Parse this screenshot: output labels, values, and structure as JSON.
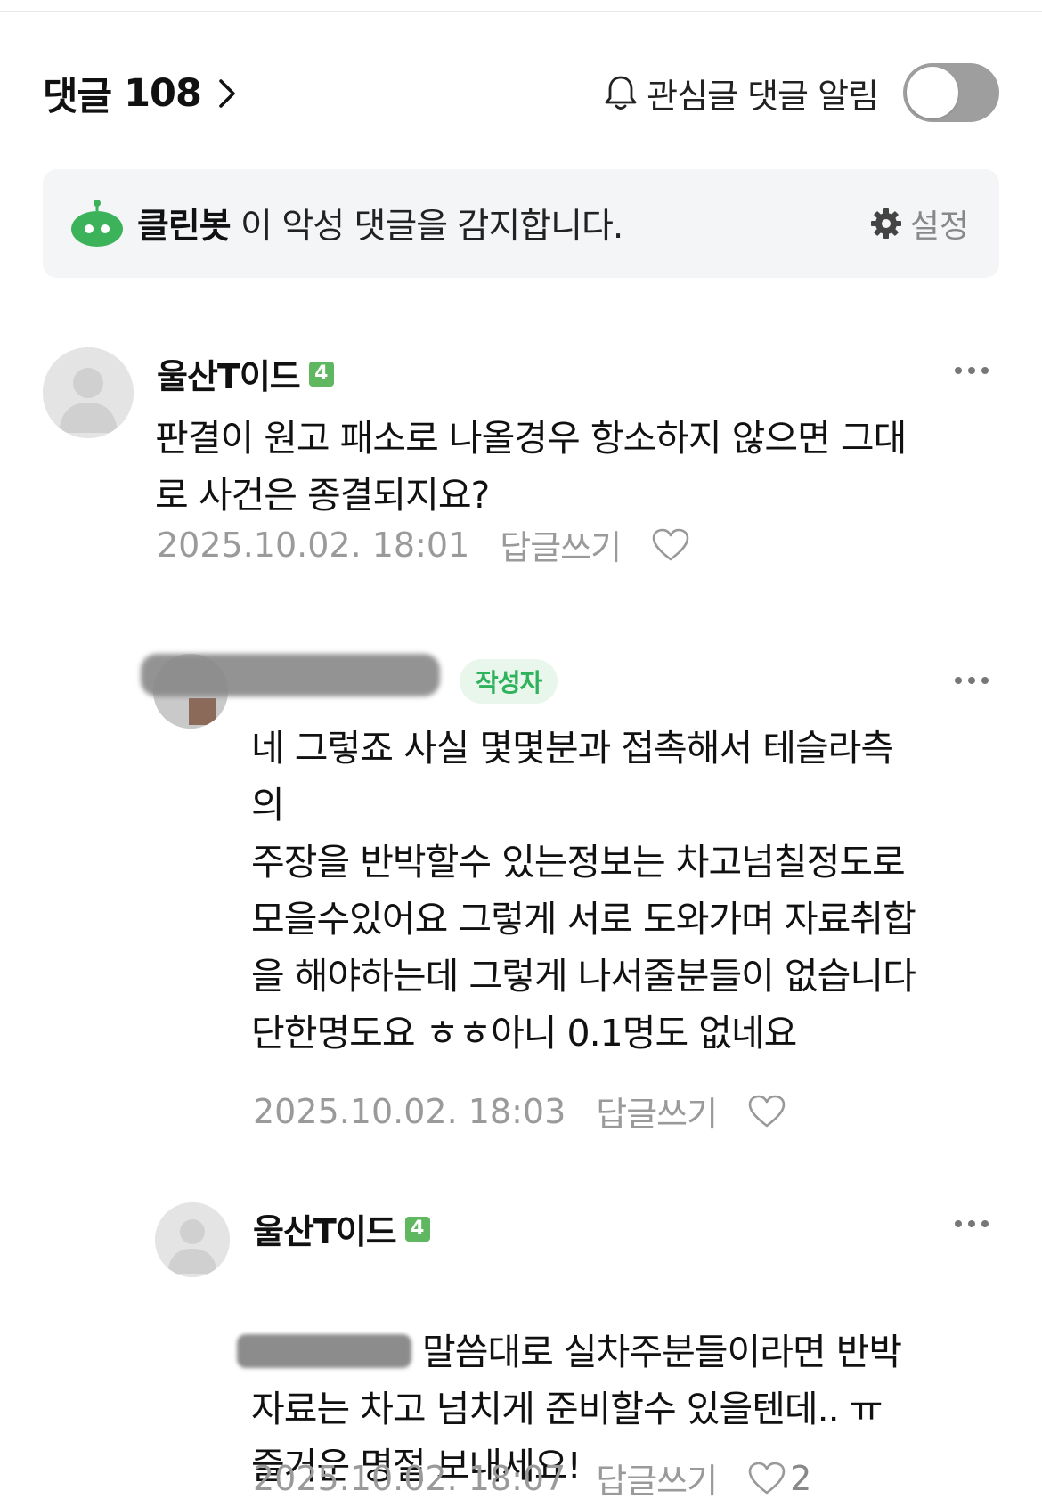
{
  "header": {
    "title": "댓글",
    "count": "108",
    "notify_label": "관심글 댓글 알림",
    "toggle_on": false
  },
  "banner": {
    "bot_name": "클린봇",
    "message": " 이 악성 댓글을 감지합니다.",
    "settings_label": "설정"
  },
  "colors": {
    "accent_green": "#2fb25b",
    "level_badge": "#5fb85f",
    "banner_bg": "#f3f5f7",
    "toggle_off": "#9e9e9e"
  },
  "comments": [
    {
      "author": "울산T이드",
      "level": "4",
      "text": "판결이 원고 패소로 나올경우 항소하지 않으면 그대\n로 사건은 종결되지요?",
      "timestamp": "2025.10.02. 18:01",
      "reply_label": "답글쓰기",
      "likes": ""
    },
    {
      "author": "",
      "writer_badge": "작성자",
      "text": "네 그렇죠 사실 몇몇분과 접촉해서 테슬라측\n의\n주장을 반박할수 있는정보는 차고넘칠정도로\n모을수있어요 그렇게 서로 도와가며 자료취합\n을 해야하는데 그렇게 나서줄분들이 없습니다\n단한명도요 ㅎㅎ아니 0.1명도 없네요",
      "timestamp": "2025.10.02. 18:03",
      "reply_label": "답글쓰기",
      "likes": ""
    },
    {
      "author": "울산T이드",
      "level": "4",
      "text_first": "말씀대로 실차주분들이라면 반박",
      "text_rest": "자료는 차고 넘치게 준비할수 있을텐데.. ㅠ\n즐거운 명절 보내세요!",
      "timestamp": "2025.10.02. 18:07",
      "reply_label": "답글쓰기",
      "likes": "2"
    }
  ]
}
